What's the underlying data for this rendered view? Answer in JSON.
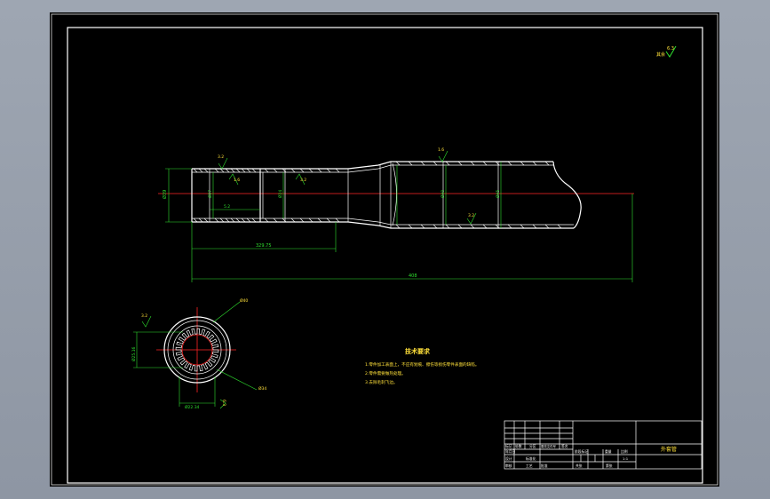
{
  "roughness": {
    "corner_symbol_value": "6.3",
    "corner_prefix": "其余",
    "values": [
      "3.2",
      "1.6",
      "3.2",
      "1.6",
      "3.2",
      "3.2",
      "6.3",
      "3.2"
    ]
  },
  "dimensions": {
    "overall_length": "408",
    "inner_length": "329.75",
    "short_length": "5.2",
    "dia_left": "Ø39",
    "dia_inner_a": "Ø27",
    "dia_inner_b": "Ø24",
    "dia_main": "Ø40",
    "dia_right": "Ø45",
    "spline_major": "Ø25.16",
    "spline_minor": "Ø22.34",
    "outer_ring": "Ø40",
    "inner_ring": "Ø34"
  },
  "notes": {
    "title": "技术要求",
    "items": [
      "1.零件加工表面上，不应有划痕、擦伤等损伤零件表面的缺陷。",
      "2.零件需要做热处理。",
      "3.去除毛刺飞边。"
    ]
  },
  "title_block": {
    "part_name": "外套管",
    "scale_value": "1:1",
    "labels": [
      "标记",
      "处数",
      "分区",
      "更改文件号",
      "签名",
      "年月日",
      "设计",
      "标准化",
      "审核",
      "工艺",
      "批准",
      "阶段标记",
      "重量",
      "比例",
      "共张",
      "第张"
    ]
  }
}
